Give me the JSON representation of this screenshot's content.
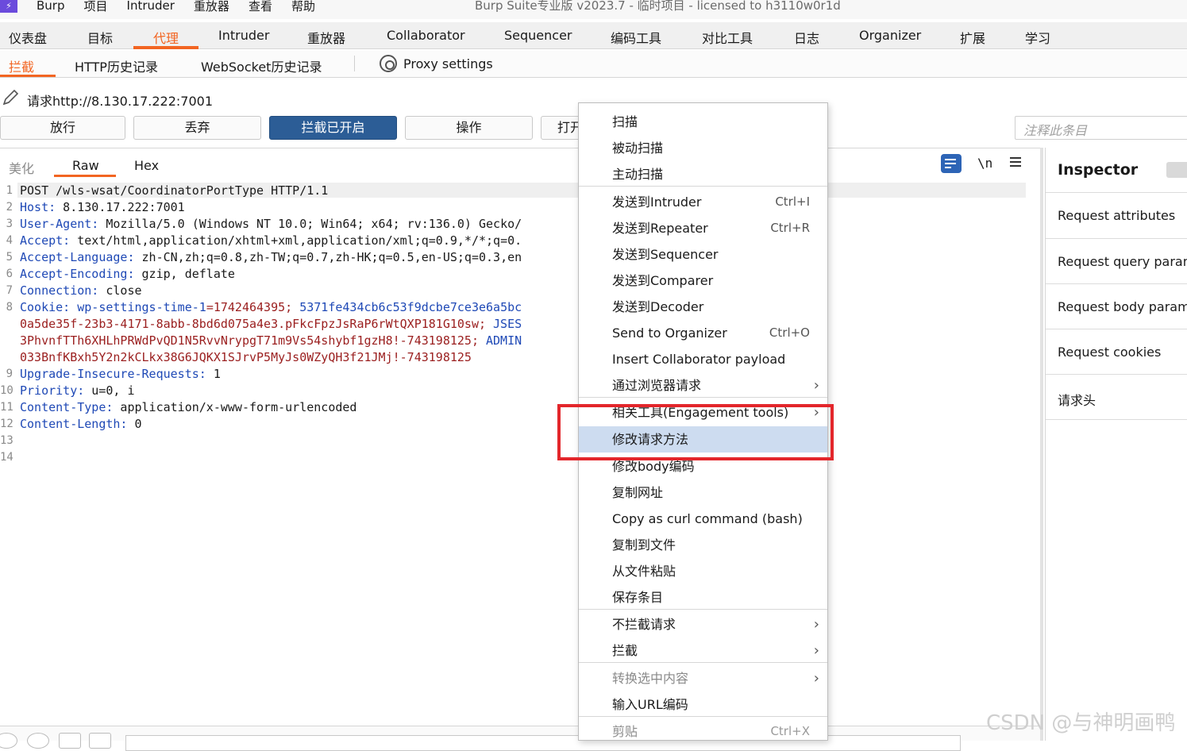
{
  "menubar": {
    "items": [
      "Burp",
      "项目",
      "Intruder",
      "重放器",
      "查看",
      "帮助"
    ],
    "window_title": "Burp Suite专业版  v2023.7 - 临时项目 - licensed to h3110w0r1d"
  },
  "top_tabs": [
    "仪表盘",
    "目标",
    "代理",
    "Intruder",
    "重放器",
    "Collaborator",
    "Sequencer",
    "编码工具",
    "对比工具",
    "日志",
    "Organizer",
    "扩展",
    "学习"
  ],
  "sub_tabs": {
    "intercept": "拦截",
    "http_history": "HTTP历史记录",
    "websocket_history": "WebSocket历史记录",
    "proxy_settings": "Proxy settings"
  },
  "request_line": "请求http://8.130.17.222:7001",
  "buttons": {
    "forward": "放行",
    "drop": "丢弃",
    "intercept_on": "拦截已开启",
    "action": "操作",
    "open_partial": "打开"
  },
  "note_placeholder": "注释此条目",
  "editor_tabs": {
    "pretty": "美化",
    "raw": "Raw",
    "hex": "Hex"
  },
  "editor_newline": "\\n",
  "request": [
    {
      "no": "1",
      "key": "",
      "text": "POST /wls-wsat/CoordinatorPortType HTTP/1.1"
    },
    {
      "no": "2",
      "key": "Host:",
      "text": " 8.130.17.222:7001"
    },
    {
      "no": "3",
      "key": "User-Agent:",
      "text": " Mozilla/5.0 (Windows NT 10.0; Win64; x64; rv:136.0) Gecko/"
    },
    {
      "no": "4",
      "key": "Accept:",
      "text": " text/html,application/xhtml+xml,application/xml;q=0.9,*/*;q=0."
    },
    {
      "no": "5",
      "key": "Accept-Language:",
      "text": " zh-CN,zh;q=0.8,zh-TW;q=0.7,zh-HK;q=0.5,en-US;q=0.3,en"
    },
    {
      "no": "6",
      "key": "Accept-Encoding:",
      "text": " gzip, deflate"
    },
    {
      "no": "7",
      "key": "Connection:",
      "text": " close"
    },
    {
      "no": "8",
      "key": "Cookie:",
      "text": ""
    },
    {
      "no": "9",
      "key": "Upgrade-Insecure-Requests:",
      "text": " 1"
    },
    {
      "no": "10",
      "key": "Priority:",
      "text": " u=0, i"
    },
    {
      "no": "11",
      "key": "Content-Type:",
      "text": " application/x-www-form-urlencoded"
    },
    {
      "no": "12",
      "key": "Content-Length:",
      "text": " 0"
    },
    {
      "no": "13",
      "key": "",
      "text": ""
    },
    {
      "no": "14",
      "key": "",
      "text": ""
    }
  ],
  "cookie": {
    "line1_k1": " wp-settings-time-1",
    "line1_v1": "=1742464395; ",
    "line1_k2": "5371fe434cb6c53f9dcbe7ce3e6a5bc",
    "line2_v": "0a5de35f-23b3-4171-8abb-8bd6d075a4e3.pFkcFpzJsRaP6rWtQXP181G10sw; ",
    "line2_k": "JSES",
    "line3_v": "3PhvnfTTh6XHLhPRWdPvQD1N5RvvNrypgT71m9Vs54shybf1gzH8!-743198125; ",
    "line3_k": "ADMIN",
    "line4_v": "033BnfKBxh5Y2n2kCLkx38G6JQKX1SJrvP5MyJs0WZyQH3f21JMj!-743198125"
  },
  "inspector": {
    "title": "Inspector",
    "rows": [
      "Request attributes",
      "Request query parameters",
      "Request body parameters",
      "Request cookies",
      "请求头"
    ]
  },
  "context_menu": {
    "scan": "扫描",
    "passive_scan": "被动扫描",
    "active_scan": "主动扫描",
    "send_intruder": "发送到Intruder",
    "send_intruder_sc": "Ctrl+I",
    "send_repeater": "发送到Repeater",
    "send_repeater_sc": "Ctrl+R",
    "send_sequencer": "发送到Sequencer",
    "send_comparer": "发送到Comparer",
    "send_decoder": "发送到Decoder",
    "send_organizer": "Send to Organizer",
    "send_organizer_sc": "Ctrl+O",
    "insert_collab": "Insert Collaborator payload",
    "browser_request": "通过浏览器请求",
    "engagement_tools": "相关工具(Engagement tools)",
    "change_method": "修改请求方法",
    "change_body_encoding": "修改body编码",
    "copy_url": "复制网址",
    "copy_curl": "Copy as curl command (bash)",
    "copy_to_file": "复制到文件",
    "paste_from_file": "从文件粘贴",
    "save_item": "保存条目",
    "dont_intercept": "不拦截请求",
    "intercept": "拦截",
    "convert_selection": "转换选中内容",
    "url_encode_typing": "输入URL编码",
    "cut": "剪贴",
    "cut_sc": "Ctrl+X"
  },
  "watermark": "CSDN @与神明画鸭",
  "colors": {
    "accent": "#f26522",
    "primary_button": "#2c5d96",
    "highlight": "#cddcf0",
    "annotation": "#e3262b",
    "header_key": "#1f49b6",
    "cookie_value": "#9b2020"
  }
}
